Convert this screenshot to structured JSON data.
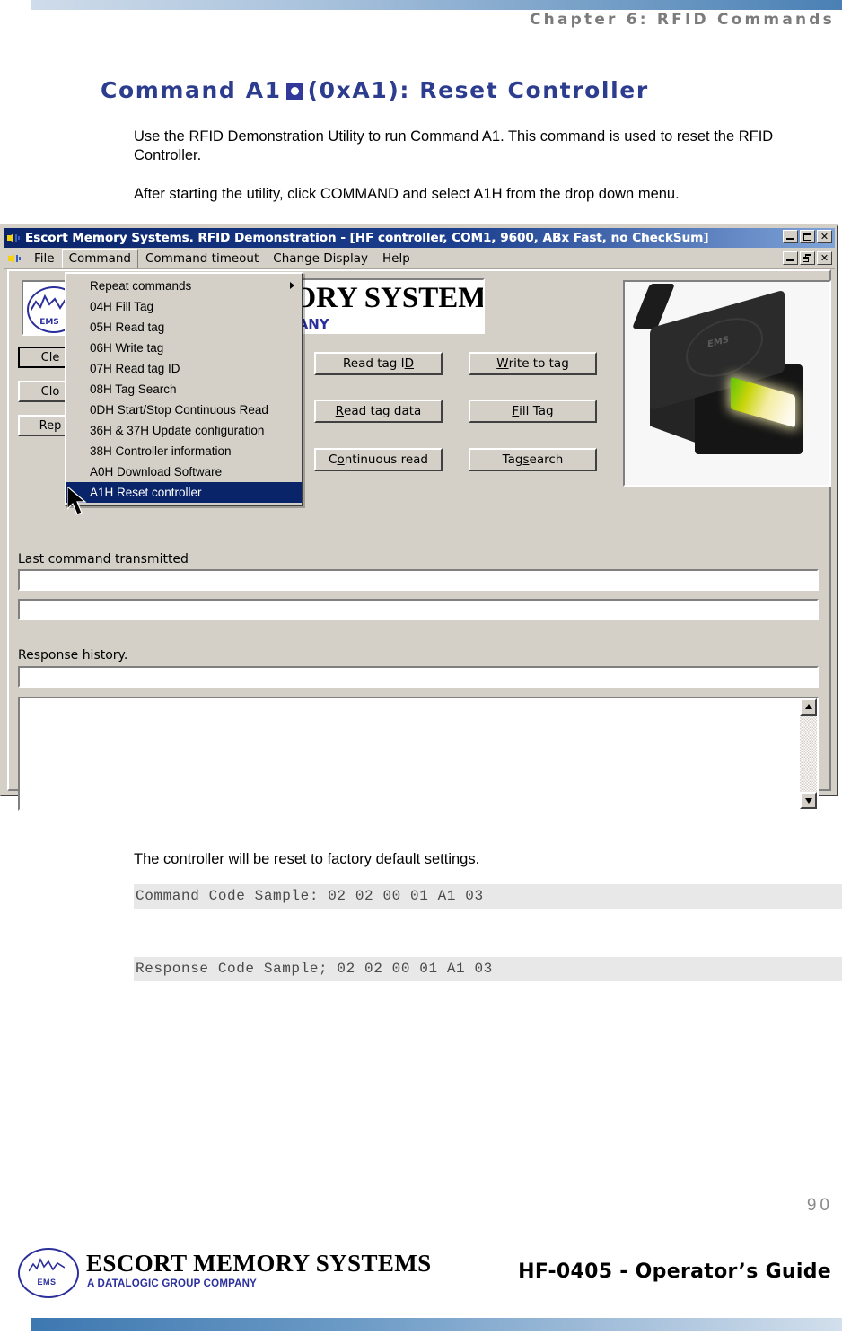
{
  "page": {
    "chapter_header": "Chapter 6: RFID Commands",
    "page_number": "90",
    "heading": "Command A1",
    "heading_tail": "(0xA1): Reset Controller",
    "paragraph_1": "Use the RFID Demonstration Utility to run Command A1. This command is used to reset the RFID Controller.",
    "paragraph_2": "After starting the utility, click COMMAND and select A1H from the drop down menu.",
    "paragraph_3": "The controller will be reset to factory default settings.",
    "command_code_sample": "Command Code Sample: 02 02 00 01 A1 03",
    "response_code_sample": "Response Code Sample; 02 02 00 01 A1 03"
  },
  "footer": {
    "logo_text": "EMS",
    "brand": "ESCORT MEMORY SYSTEMS",
    "tagline": "A DATALOGIC GROUP COMPANY",
    "guide": "HF-0405 - Operator’s Guide"
  },
  "app": {
    "title": "Escort Memory Systems.   RFID Demonstration - [HF controller, COM1, 9600, ABx Fast, no CheckSum]",
    "menubar": [
      "File",
      "Command",
      "Command timeout",
      "Change Display",
      "Help"
    ],
    "window_buttons": {
      "minimize": "_",
      "maximize": "□",
      "restore": "❐",
      "close": "✕"
    },
    "banner": {
      "line1": "ESCORT MEMORY SYSTEMS",
      "line2": "A DATALOGIC GROUP COMPANY"
    },
    "logo_text": "EMS",
    "device_label": "EMS",
    "left_buttons": [
      {
        "label": "Clear",
        "visible_text": "Cle"
      },
      {
        "label": "Close",
        "visible_text": "Clo"
      },
      {
        "label": "Repeat",
        "visible_text": "Rep"
      }
    ],
    "action_buttons": [
      {
        "label": "Read tag ID",
        "pre": "Read tag I",
        "accel": "D",
        "post": ""
      },
      {
        "label": "Write to tag",
        "pre": "",
        "accel": "W",
        "post": "rite to tag"
      },
      {
        "label": "Read tag data",
        "pre": "",
        "accel": "R",
        "post": "ead tag data"
      },
      {
        "label": "Fill Tag",
        "pre": "",
        "accel": "F",
        "post": "ill Tag"
      },
      {
        "label": "Continuous read",
        "pre": "C",
        "accel": "o",
        "post": "ntinuous read"
      },
      {
        "label": "Tag search",
        "pre": "Tag ",
        "accel": "s",
        "post": "earch"
      }
    ],
    "fields": {
      "last_command_label": "Last command transmitted",
      "last_command_value_1": "",
      "last_command_value_2": "",
      "response_history_label": "Response history.",
      "response_history_value": "",
      "response_history_log": ""
    },
    "dropdown": {
      "items": [
        {
          "label": "Repeat commands",
          "submenu": true,
          "selected": false
        },
        {
          "label": "04H Fill Tag",
          "submenu": false,
          "selected": false
        },
        {
          "label": "05H Read tag",
          "submenu": false,
          "selected": false
        },
        {
          "label": "06H Write tag",
          "submenu": false,
          "selected": false
        },
        {
          "label": "07H Read tag ID",
          "submenu": false,
          "selected": false
        },
        {
          "label": "08H Tag Search",
          "submenu": false,
          "selected": false
        },
        {
          "label": "0DH Start/Stop Continuous Read",
          "submenu": false,
          "selected": false
        },
        {
          "label": "36H & 37H Update configuration",
          "submenu": false,
          "selected": false
        },
        {
          "label": "38H Controller information",
          "submenu": false,
          "selected": false
        },
        {
          "label": "A0H Download Software",
          "submenu": false,
          "selected": false
        },
        {
          "label": "A1H Reset controller",
          "submenu": false,
          "selected": true
        }
      ]
    }
  },
  "colors": {
    "heading": "#2c3c8e",
    "titlebar": "#0a246a",
    "menu_highlight": "#0a246a",
    "chrome": "#d4d0c8",
    "code_band": "#e8e8e8",
    "brand_blue": "#2a2f9c"
  }
}
